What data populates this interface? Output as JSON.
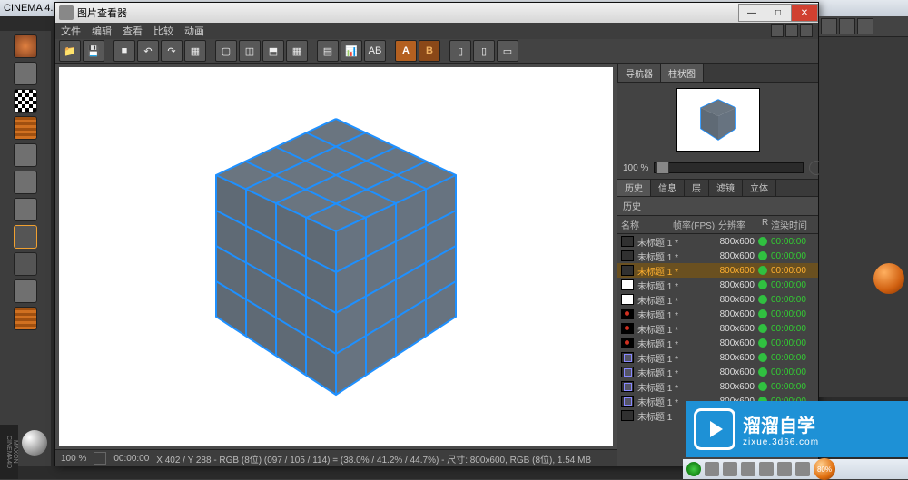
{
  "app": {
    "title": "CINEMA 4..."
  },
  "pv": {
    "title": "图片查看器",
    "menu": [
      "文件",
      "编辑",
      "查看",
      "比较",
      "动画"
    ],
    "zoom_label": "100 %",
    "status": {
      "zoom": "100 %",
      "time": "00:00:00",
      "info": "X 402 / Y 288 - RGB (8位) (097 / 105 / 114) = (38.0% / 41.2% / 44.7%) - 尺寸: 800x600, RGB (8位), 1.54 MB"
    },
    "side_tabs": [
      "导航器",
      "柱状图"
    ],
    "tabs2": [
      "历史",
      "信息",
      "层",
      "滤镜",
      "立体"
    ],
    "history_title": "历史",
    "cols": {
      "name": "名称",
      "fps": "帧率(FPS)",
      "res": "分辨率",
      "r": "R",
      "time": "渲染时间"
    },
    "rows": [
      {
        "icon": "dark",
        "name": "未标题 1 *",
        "res": "800x600",
        "time": "00:00:00"
      },
      {
        "icon": "dark",
        "name": "未标题 1 *",
        "res": "800x600",
        "time": "00:00:00"
      },
      {
        "icon": "dark",
        "name": "未标题 1 *",
        "res": "800x600",
        "time": "00:00:00",
        "sel": true
      },
      {
        "icon": "white",
        "name": "未标题 1 *",
        "res": "800x600",
        "time": "00:00:00"
      },
      {
        "icon": "white",
        "name": "未标题 1 *",
        "res": "800x600",
        "time": "00:00:00"
      },
      {
        "icon": "dot",
        "name": "未标题 1 *",
        "res": "800x600",
        "time": "00:00:00"
      },
      {
        "icon": "dot",
        "name": "未标题 1 *",
        "res": "800x600",
        "time": "00:00:00"
      },
      {
        "icon": "dot",
        "name": "未标题 1 *",
        "res": "800x600",
        "time": "00:00:00"
      },
      {
        "icon": "mini",
        "name": "未标题 1 *",
        "res": "800x600",
        "time": "00:00:00"
      },
      {
        "icon": "mini",
        "name": "未标题 1 *",
        "res": "800x600",
        "time": "00:00:00"
      },
      {
        "icon": "mini",
        "name": "未标题 1 *",
        "res": "800x600",
        "time": "00:00:00"
      },
      {
        "icon": "mini",
        "name": "未标题 1 *",
        "res": "800x600",
        "time": "00:00:00"
      },
      {
        "icon": "dark",
        "name": "未标题 1",
        "res": "",
        "time": ""
      }
    ]
  },
  "watermark": {
    "title": "溜溜自学",
    "sub": "zixue.3d66.com"
  },
  "taskbar_pct": "80%"
}
